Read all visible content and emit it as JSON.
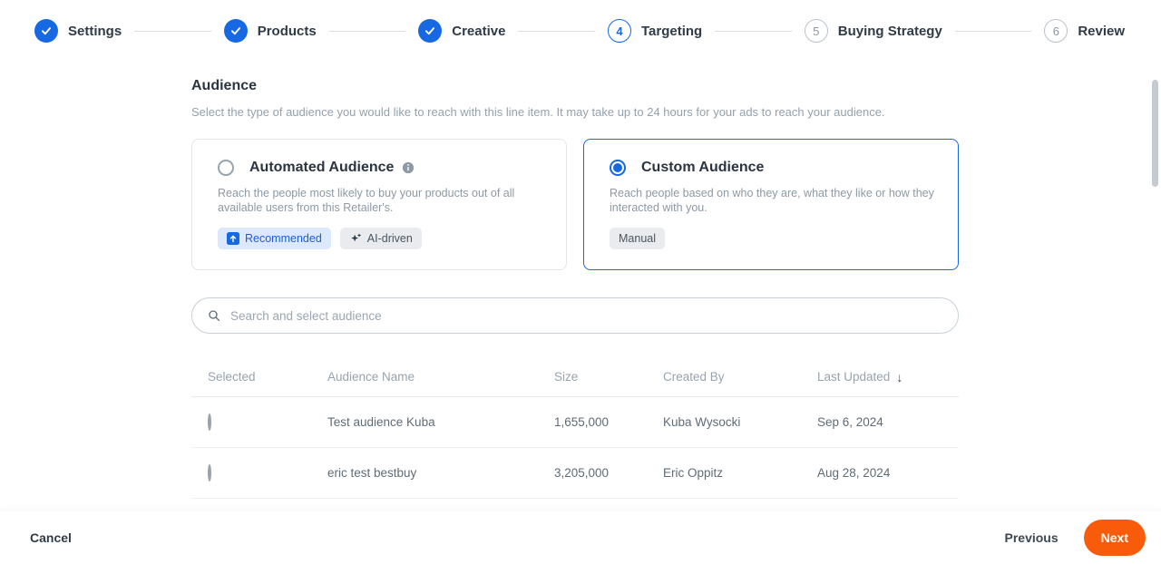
{
  "stepper": {
    "steps": [
      {
        "label": "Settings",
        "state": "done"
      },
      {
        "label": "Products",
        "state": "done"
      },
      {
        "label": "Creative",
        "state": "done"
      },
      {
        "label": "Targeting",
        "state": "current",
        "number": "4"
      },
      {
        "label": "Buying Strategy",
        "state": "upcoming",
        "number": "5"
      },
      {
        "label": "Review",
        "state": "upcoming",
        "number": "6"
      }
    ]
  },
  "audience": {
    "title": "Audience",
    "description": "Select the type of audience you would like to reach with this line item. It may take up to 24 hours for your ads to reach your audience.",
    "automated": {
      "title": "Automated Audience",
      "description": "Reach the people most likely to buy your products out of all available users from this Retailer's.",
      "badge_recommended": "Recommended",
      "badge_ai": "AI-driven",
      "selected": false
    },
    "custom": {
      "title": "Custom Audience",
      "description": "Reach people based on who they are, what they like or how they interacted with you.",
      "badge_manual": "Manual",
      "selected": true
    }
  },
  "search": {
    "placeholder": "Search and select audience"
  },
  "table": {
    "headers": [
      "Selected",
      "Audience Name",
      "Size",
      "Created By",
      "Last Updated"
    ],
    "sort_direction": "descending",
    "rows": [
      {
        "name": "Test audience Kuba",
        "size": "1,655,000",
        "created_by": "Kuba Wysocki",
        "last_updated": "Sep 6, 2024"
      },
      {
        "name": "eric test bestbuy",
        "size": "3,205,000",
        "created_by": "Eric Oppitz",
        "last_updated": "Aug 28, 2024"
      }
    ]
  },
  "footer": {
    "cancel": "Cancel",
    "previous": "Previous",
    "next": "Next"
  },
  "icons": {
    "sort_desc": "↓"
  },
  "colors": {
    "primary_blue": "#1668E3",
    "accent_orange": "#F85C0A",
    "badge_blue_bg": "#dce8fb",
    "badge_gray_bg": "#e9ebee"
  }
}
